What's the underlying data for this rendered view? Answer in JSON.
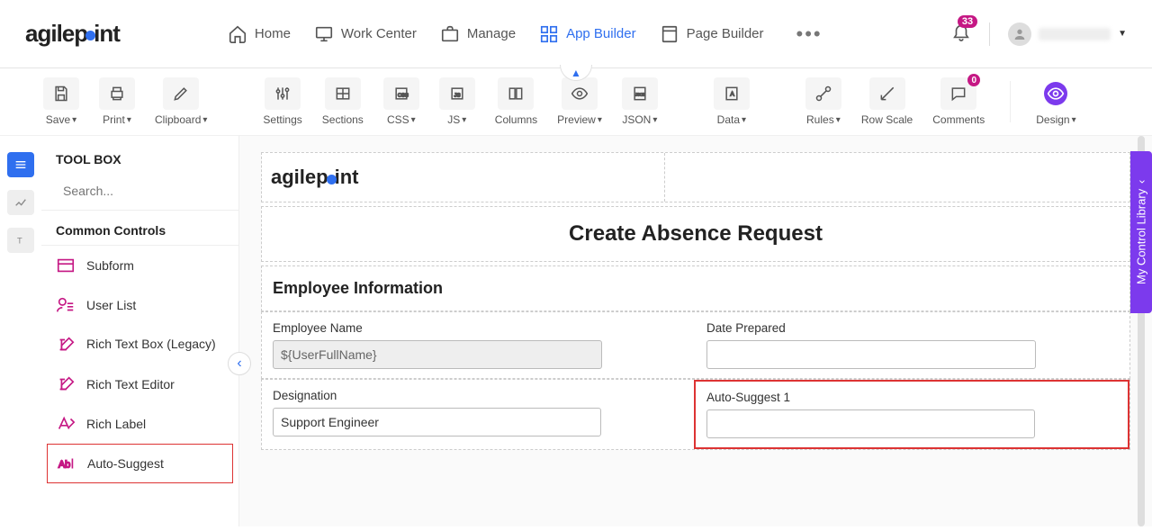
{
  "brand": "agilepoint",
  "nav": {
    "home": "Home",
    "work_center": "Work Center",
    "manage": "Manage",
    "app_builder": "App Builder",
    "page_builder": "Page Builder"
  },
  "notifications_count": "33",
  "toolbar": {
    "save": "Save",
    "print": "Print",
    "clipboard": "Clipboard",
    "settings": "Settings",
    "sections": "Sections",
    "css": "CSS",
    "js": "JS",
    "columns": "Columns",
    "preview": "Preview",
    "json": "JSON",
    "data": "Data",
    "rules": "Rules",
    "row_scale": "Row Scale",
    "comments": "Comments",
    "comments_count": "0",
    "design": "Design"
  },
  "sidebar": {
    "title": "TOOL BOX",
    "search_placeholder": "Search...",
    "group": "Common Controls",
    "items": {
      "subform": "Subform",
      "user_list": "User List",
      "rich_text_legacy": "Rich Text Box (Legacy)",
      "rich_text_editor": "Rich Text Editor",
      "rich_label": "Rich Label",
      "auto_suggest": "Auto-Suggest"
    }
  },
  "form": {
    "title": "Create Absence Request",
    "section": "Employee Information",
    "employee_name": {
      "label": "Employee Name",
      "value": "${UserFullName}"
    },
    "date_prepared": {
      "label": "Date Prepared",
      "value": ""
    },
    "designation": {
      "label": "Designation",
      "value": "Support Engineer"
    },
    "auto_suggest": {
      "label": "Auto-Suggest 1",
      "value": ""
    }
  },
  "library_label": "My Control Library"
}
